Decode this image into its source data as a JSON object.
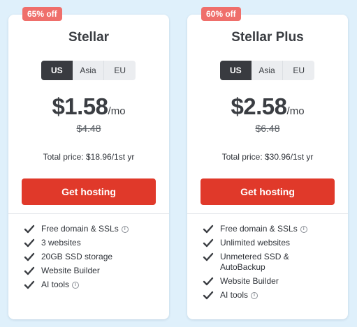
{
  "plans": [
    {
      "badge": "65% off",
      "name": "Stellar",
      "regions": [
        "US",
        "Asia",
        "EU"
      ],
      "selected_region": "US",
      "price": "$1.58",
      "per": "/mo",
      "old_price": "$4.48",
      "total": "Total price: $18.96/1st yr",
      "cta": "Get hosting",
      "features": [
        {
          "text": "Free domain & SSLs",
          "info": true
        },
        {
          "text": "3 websites",
          "info": false
        },
        {
          "text": "20GB SSD storage",
          "info": false
        },
        {
          "text": "Website Builder",
          "info": false
        },
        {
          "text": "AI tools",
          "info": true
        }
      ]
    },
    {
      "badge": "60% off",
      "name": "Stellar Plus",
      "regions": [
        "US",
        "Asia",
        "EU"
      ],
      "selected_region": "US",
      "price": "$2.58",
      "per": "/mo",
      "old_price": "$6.48",
      "total": "Total price: $30.96/1st yr",
      "cta": "Get hosting",
      "features": [
        {
          "text": "Free domain & SSLs",
          "info": true
        },
        {
          "text": "Unlimited websites",
          "info": false
        },
        {
          "text": "Unmetered SSD & AutoBackup",
          "info": false
        },
        {
          "text": "Website Builder",
          "info": false
        },
        {
          "text": "AI tools",
          "info": true
        }
      ]
    }
  ],
  "info_glyph": "i",
  "colors": {
    "background": "#dff0fb",
    "badge": "#ef6f6b",
    "cta": "#e0392a",
    "region_active": "#393b40"
  },
  "icons": {
    "check": "check-icon",
    "info": "info-icon"
  }
}
